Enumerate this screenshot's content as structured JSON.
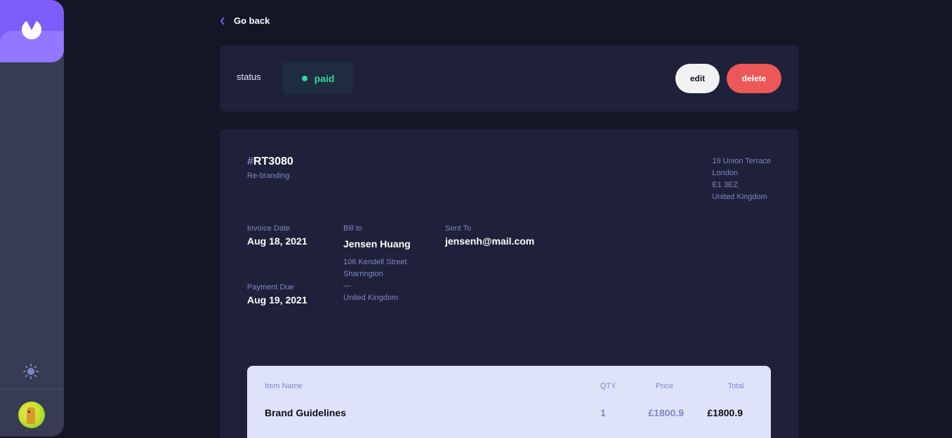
{
  "nav": {
    "back_label": "Go back"
  },
  "status_bar": {
    "label": "status",
    "status": "paid",
    "edit_label": "edit",
    "delete_label": "delete"
  },
  "invoice": {
    "id_hash": "#",
    "id": "RT3080",
    "description": "Re-branding",
    "sender_address": [
      "19 Union Terrace",
      "London",
      "E1 3EZ",
      "United Kingdom"
    ],
    "invoice_date_label": "Invoice Date",
    "invoice_date": "Aug 18, 2021",
    "payment_due_label": "Payment Due",
    "payment_due": "Aug 19, 2021",
    "bill_to_label": "Bill to",
    "client_name": "Jensen Huang",
    "client_address": [
      "106 Kendell Street",
      "Sharrington",
      "—",
      "United Kingdom"
    ],
    "sent_to_label": "Sent To",
    "client_email": "jensenh@mail.com"
  },
  "items_table": {
    "headers": {
      "name": "Item Name",
      "qty": "QTY.",
      "price": "Price",
      "total": "Total"
    },
    "rows": [
      {
        "name": "Brand Guidelines",
        "qty": "1",
        "price": "£1800.9",
        "total": "£1800.9"
      }
    ]
  },
  "colors": {
    "accent": "#7c5dfa",
    "paid": "#33d69f",
    "danger": "#ec5757",
    "background": "#141625",
    "card": "#1e2139"
  }
}
